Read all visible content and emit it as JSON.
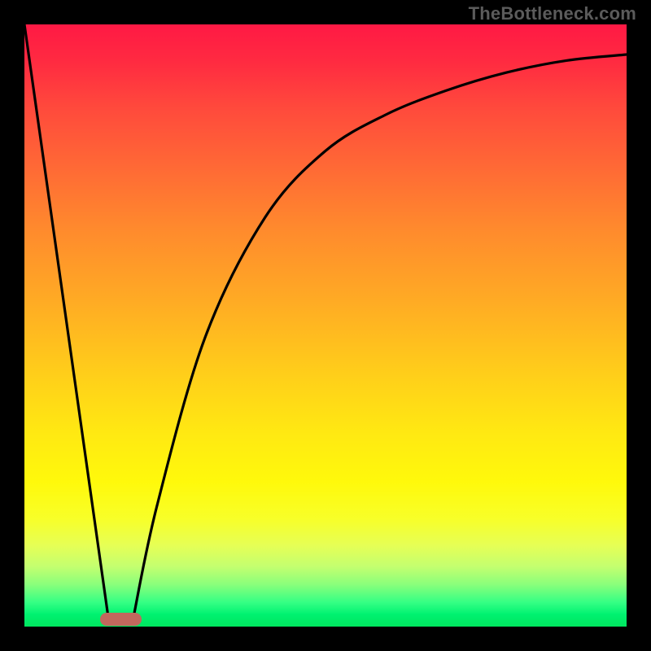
{
  "attribution": "TheBottleneck.com",
  "chart_data": {
    "type": "line",
    "title": "",
    "xlabel": "",
    "ylabel": "",
    "xlim": [
      0,
      100
    ],
    "ylim": [
      0,
      100
    ],
    "series": [
      {
        "name": "left-branch",
        "x": [
          0,
          14
        ],
        "values": [
          100,
          1
        ]
      },
      {
        "name": "right-branch",
        "x": [
          18,
          22,
          30,
          40,
          50,
          60,
          70,
          80,
          90,
          100
        ],
        "values": [
          1,
          20,
          48,
          68,
          79,
          85,
          89,
          92,
          94,
          95
        ]
      }
    ],
    "annotations": [
      {
        "name": "trough-bump",
        "x_center": 16,
        "y": 1,
        "width": 7
      }
    ],
    "grid": false,
    "legend": false,
    "background": {
      "type": "vertical-gradient",
      "stops": [
        {
          "pos": 0,
          "color": "#ff1944"
        },
        {
          "pos": 24,
          "color": "#ff6a35"
        },
        {
          "pos": 58,
          "color": "#ffce1a"
        },
        {
          "pos": 76,
          "color": "#fff90b"
        },
        {
          "pos": 96,
          "color": "#34ff84"
        },
        {
          "pos": 100,
          "color": "#00e65f"
        }
      ]
    }
  },
  "colors": {
    "curve": "#000000",
    "bump": "#c1685d",
    "frame": "#000000"
  }
}
